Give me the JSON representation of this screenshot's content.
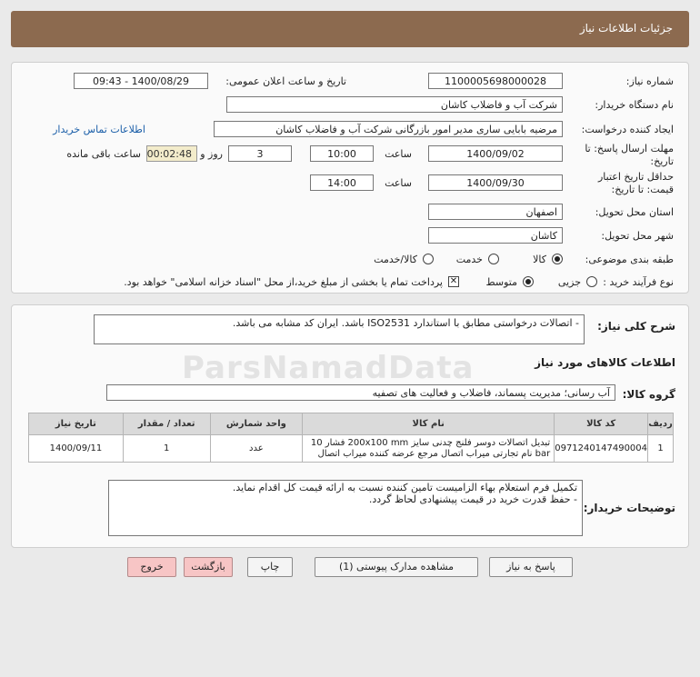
{
  "header": {
    "title": "جزئیات اطلاعات نیاز"
  },
  "details": {
    "need_number_label": "شماره نیاز:",
    "need_number": "1100005698000028",
    "announce_label": "تاریخ و ساعت اعلان عمومی:",
    "announce_value": "1400/08/29 - 09:43",
    "buyer_org_label": "نام دستگاه خریدار:",
    "buyer_org": "شرکت آب و فاضلاب کاشان",
    "requester_label": "ایجاد کننده درخواست:",
    "requester": "مرضیه بابایی ساری مدیر امور بازرگانی شرکت آب و فاضلاب کاشان",
    "contact_link": "اطلاعات تماس خریدار",
    "deadline_label_1": "مهلت ارسال پاسخ: تا",
    "deadline_label_2": "تاریخ:",
    "deadline_date": "1400/09/02",
    "time_label": "ساعت",
    "deadline_time": "10:00",
    "days_value": "3",
    "days_label": "روز و",
    "remaining_time": "00:02:48",
    "remaining_label": "ساعت باقی مانده",
    "validity_label_1": "حداقل تاریخ اعتبار",
    "validity_label_2": "قیمت: تا تاریخ:",
    "validity_date": "1400/09/30",
    "validity_time": "14:00",
    "province_label": "استان محل تحویل:",
    "province": "اصفهان",
    "city_label": "شهر محل تحویل:",
    "city": "کاشان",
    "category_label": "طبقه بندی موضوعی:",
    "category_options": [
      "کالا",
      "خدمت",
      "کالا/خدمت"
    ],
    "category_selected": "کالا",
    "process_label": "نوع فرآیند خرید :",
    "process_options": [
      "جزیی",
      "متوسط"
    ],
    "process_selected": "متوسط",
    "payment_note": "پرداخت تمام یا بخشی از مبلغ خرید،از محل \"اسناد خزانه اسلامی\" خواهد بود."
  },
  "description": {
    "label": "شرح کلی نیاز:",
    "text": "- اتصالات درخواستی مطابق با استاندارد ISO2531  باشد.            ایران کد مشابه می باشد."
  },
  "goods": {
    "section_title": "اطلاعات کالاهای مورد نیاز",
    "group_label": "گروه کالا:",
    "group_value": "آب رسانی؛ مدیریت پسماند، فاضلاب و فعالیت های تصفیه",
    "columns": [
      "ردیف",
      "کد کالا",
      "نام کالا",
      "واحد شمارش",
      "تعداد / مقدار",
      "تاریخ نیاز"
    ],
    "rows": [
      {
        "index": "1",
        "code": "0971240147490004",
        "name_line1": "تبدیل اتصالات دوسر فلنج چدنی سایز 200x100 mm فشار 10",
        "name_line2": "bar نام تجارتی میراب اتصال مرجع عرضه کننده میراب اتصال",
        "unit": "عدد",
        "qty": "1",
        "date": "1400/09/11"
      }
    ]
  },
  "notes": {
    "label": "توضیحات خریدار:",
    "line1": "تکمیل فرم استعلام بهاء الزامیست              تامین کننده نسبت به ارائه قیمت کل اقدام نماید.",
    "line2": "- حفظ قدرت خرید در قیمت پیشنهادی لحاظ گردد."
  },
  "buttons": {
    "reply": "پاسخ به نیاز",
    "attachments": "مشاهده مدارک پیوستی (1)",
    "print": "چاپ",
    "back": "بازگشت",
    "exit": "خروج"
  },
  "watermark": "ParsNamadData"
}
